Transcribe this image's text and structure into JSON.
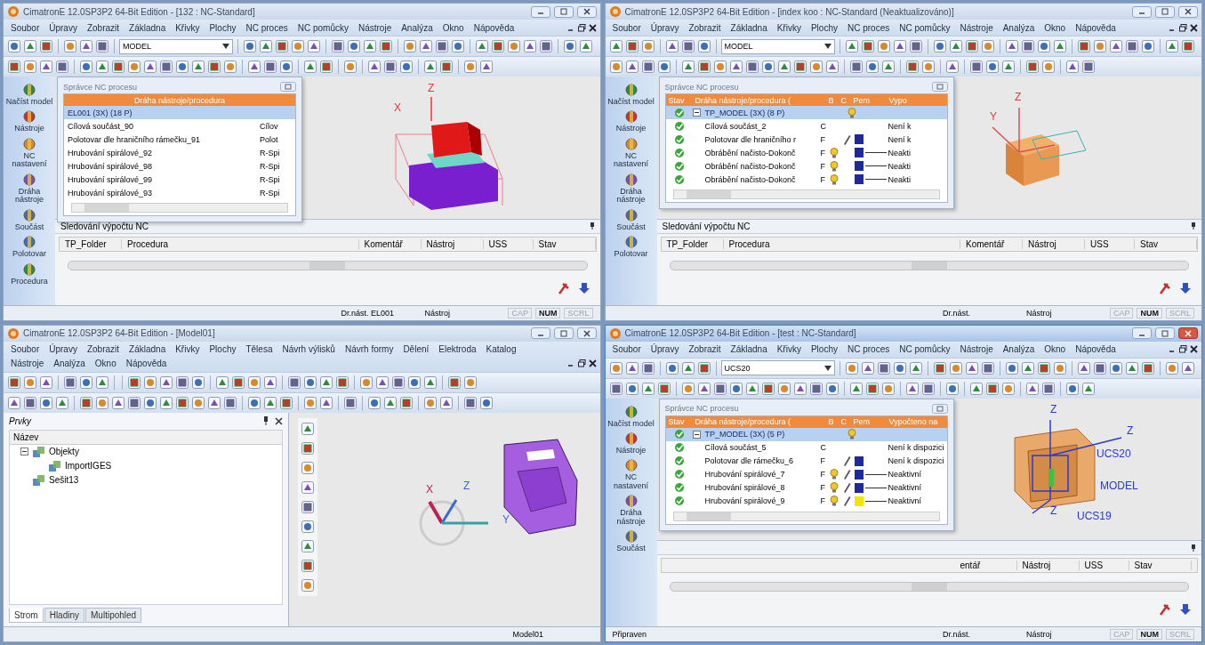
{
  "windows": [
    {
      "title": "CimatronE 12.0SP3P2 64-Bit Edition - [132 : NC-Standard]",
      "active": false,
      "kind": "nc",
      "menu_lines": [
        [
          "Soubor",
          "Úpravy",
          "Zobrazit",
          "Základna",
          "Křivky",
          "Plochy",
          "NC proces",
          "NC pomůcky",
          "Nástroje",
          "Analýza",
          "Okno",
          "Nápověda"
        ]
      ],
      "combo": "MODEL",
      "side_buttons": [
        "Načíst model",
        "Nástroje",
        "NC nastavení",
        "Dráha nástroje",
        "Součást",
        "Polotovar",
        "Procedura"
      ],
      "manager": {
        "kind": "plain",
        "title": "Správce NC procesu",
        "columns": [
          "Dráha nástroje/procedura"
        ],
        "rows": [
          {
            "kind": "folder",
            "name": "EL001 (3X) (18 P)",
            "selected": true
          },
          {
            "kind": "item",
            "name": "Cílová součást_90",
            "status": "Cílov",
            "selected": false
          },
          {
            "kind": "item",
            "name": "Polotovar dle hraničního rámečku_91",
            "status": "Polot",
            "selected": false
          },
          {
            "kind": "item",
            "name": "Hrubování spirálové_92",
            "status": "R-Spi",
            "selected": false
          },
          {
            "kind": "item",
            "name": "Hrubování spirálové_98",
            "status": "R-Spi",
            "selected": false
          },
          {
            "kind": "item",
            "name": "Hrubování spirálové_99",
            "status": "R-Spi",
            "selected": false
          },
          {
            "kind": "item",
            "name": "Hrubování spirálové_93",
            "status": "R-Spi",
            "selected": false
          }
        ]
      },
      "viewport": {
        "kind": "red-block",
        "labels": [
          "Z",
          "X"
        ]
      },
      "monitor": {
        "title": "Sledování výpočtu NC",
        "columns": [
          "TP_Folder",
          "Procedura",
          "Komentář",
          "Nástroj",
          "USS",
          "Stav"
        ]
      },
      "status": [
        {
          "kind": "field",
          "text": "Dr.nást. EL001"
        },
        {
          "kind": "field",
          "text": "Nástroj"
        },
        {
          "kind": "key",
          "text": "CAP",
          "on": false
        },
        {
          "kind": "key",
          "text": "NUM",
          "on": true
        },
        {
          "kind": "key",
          "text": "SCRL",
          "on": false
        }
      ]
    },
    {
      "title": "CimatronE 12.0SP3P2 64-Bit Edition - [index koo : NC-Standard (Neaktualizováno)]",
      "active": false,
      "kind": "nc",
      "menu_lines": [
        [
          "Soubor",
          "Úpravy",
          "Zobrazit",
          "Základna",
          "Křivky",
          "Plochy",
          "NC proces",
          "NC pomůcky",
          "Nástroje",
          "Analýza",
          "Okno",
          "Nápověda"
        ]
      ],
      "combo": "MODEL",
      "side_buttons": [
        "Načíst model",
        "Nástroje",
        "NC nastavení",
        "Dráha nástroje",
        "Součást",
        "Polotovar"
      ],
      "manager": {
        "kind": "status",
        "title": "Správce NC procesu",
        "columns": [
          "Stav",
          "Dráha nástroje/procedura (",
          "B",
          "C",
          "Pem",
          "Vypo"
        ],
        "rows": [
          {
            "kind": "folder",
            "name": "TP_MODEL (3X) (8 P)",
            "bulb": true,
            "tool": false,
            "selected": true
          },
          {
            "kind": "item",
            "name": "Cílová součást_2",
            "flag": "C",
            "bulb": false,
            "tool": false,
            "status": "Není k",
            "selected": false
          },
          {
            "kind": "item",
            "name": "Polotovar dle hraničního r",
            "flag": "F",
            "bulb": false,
            "tool": true,
            "color": "#1c2a9c",
            "status": "Není k",
            "selected": false
          },
          {
            "kind": "operation",
            "name": "Obrábění načisto-Dokonč",
            "flag": "F",
            "bulb": true,
            "tool": false,
            "color": "#1c2a9c",
            "status": "Neakti",
            "selected": false
          },
          {
            "kind": "operation",
            "name": "Obrábění načisto-Dokonč",
            "flag": "F",
            "bulb": true,
            "tool": false,
            "color": "#1c2a9c",
            "status": "Neakti",
            "selected": false
          },
          {
            "kind": "operation",
            "name": "Obrábění načisto-Dokonč",
            "flag": "F",
            "bulb": true,
            "tool": false,
            "color": "#1c2a9c",
            "status": "Neakti",
            "selected": false
          }
        ]
      },
      "viewport": {
        "kind": "orange-box",
        "labels": [
          "Z",
          "Y"
        ]
      },
      "monitor": {
        "title": "Sledování výpočtu NC",
        "columns": [
          "TP_Folder",
          "Procedura",
          "Komentář",
          "Nástroj",
          "USS",
          "Stav"
        ]
      },
      "status": [
        {
          "kind": "field",
          "text": "Dr.nást."
        },
        {
          "kind": "field",
          "text": "Nástroj"
        },
        {
          "kind": "key",
          "text": "CAP",
          "on": false
        },
        {
          "kind": "key",
          "text": "NUM",
          "on": true
        },
        {
          "kind": "key",
          "text": "SCRL",
          "on": false
        }
      ]
    },
    {
      "title": "CimatronE 12.0SP3P2 64-Bit Edition - [Model01]",
      "active": false,
      "kind": "features",
      "menu_lines": [
        [
          "Soubor",
          "Úpravy",
          "Zobrazit",
          "Základna",
          "Křivky",
          "Plochy",
          "Tělesa",
          "Návrh výlisků",
          "Návrh formy",
          "Dělení",
          "Elektroda",
          "Katalog"
        ],
        [
          "Nástroje",
          "Analýza",
          "Okno",
          "Nápověda"
        ]
      ],
      "features": {
        "title": "Prvky",
        "column": "Název",
        "tree": [
          {
            "label": "Objekty",
            "expanded": true,
            "children": [
              {
                "label": "ImportIGES"
              }
            ]
          },
          {
            "label": "Sešit13"
          }
        ],
        "tabs": [
          {
            "label": "Strom",
            "selected": true
          },
          {
            "label": "Hladiny",
            "selected": false
          },
          {
            "label": "Multipohled",
            "selected": false
          }
        ]
      },
      "viewport": {
        "kind": "purple-part",
        "labels": [
          "X",
          "Z",
          "Y"
        ]
      },
      "status": [
        {
          "kind": "field",
          "text": "Model01"
        }
      ]
    },
    {
      "title": "CimatronE 12.0SP3P2 64-Bit Edition - [test : NC-Standard]",
      "active": true,
      "kind": "nc",
      "menu_lines": [
        [
          "Soubor",
          "Úpravy",
          "Zobrazit",
          "Základna",
          "Křivky",
          "Plochy",
          "NC proces",
          "NC pomůcky",
          "Nástroje",
          "Analýza",
          "Okno",
          "Nápověda"
        ]
      ],
      "combo": "UCS20",
      "side_buttons": [
        "Načíst model",
        "Nástroje",
        "NC nastavení",
        "Dráha nástroje",
        "Součást"
      ],
      "manager": {
        "kind": "status",
        "title": "Správce NC procesu",
        "columns": [
          "Stav",
          "Dráha nástroje/procedura (",
          "B",
          "C",
          "Pem",
          "Vypočteno na"
        ],
        "rows": [
          {
            "kind": "folder",
            "name": "TP_MODEL (3X) (5 P)",
            "bulb": true,
            "tool": false,
            "selected": true
          },
          {
            "kind": "item",
            "name": "Cílová součást_5",
            "flag": "C",
            "bulb": false,
            "tool": false,
            "status": "Není k dispozici",
            "selected": false
          },
          {
            "kind": "item",
            "name": "Polotovar dle rámečku_6",
            "flag": "F",
            "bulb": false,
            "tool": true,
            "color": "#1c2a9c",
            "status": "Není k dispozici",
            "selected": false
          },
          {
            "kind": "operation",
            "name": "Hrubování spirálové_7",
            "flag": "F",
            "bulb": true,
            "tool": true,
            "color": "#1c2a9c",
            "status": "Neaktivní",
            "selected": false
          },
          {
            "kind": "operation",
            "name": "Hrubování spirálové_8",
            "flag": "F",
            "bulb": true,
            "tool": true,
            "color": "#1c2a9c",
            "status": "Neaktivní",
            "selected": false
          },
          {
            "kind": "operation",
            "name": "Hrubování spirálové_9",
            "flag": "F",
            "bulb": true,
            "tool": true,
            "color": "#f2e600",
            "status": "Neaktivní",
            "selected": false
          }
        ]
      },
      "viewport": {
        "kind": "orange-ucs",
        "labels": [
          "Z",
          "Z",
          "UCS20",
          "MODEL",
          "UCS19",
          "Z"
        ]
      },
      "monitor": {
        "covered": true,
        "columns": [
          "entář",
          "Nástroj",
          "USS",
          "Stav"
        ]
      },
      "status": [
        {
          "kind": "message",
          "text": "Připraven"
        },
        {
          "kind": "field",
          "text": "Dr.nást."
        },
        {
          "kind": "field",
          "text": "Nástroj"
        },
        {
          "kind": "key",
          "text": "CAP",
          "on": false
        },
        {
          "kind": "key",
          "text": "NUM",
          "on": true
        },
        {
          "kind": "key",
          "text": "SCRL",
          "on": false
        }
      ]
    }
  ]
}
